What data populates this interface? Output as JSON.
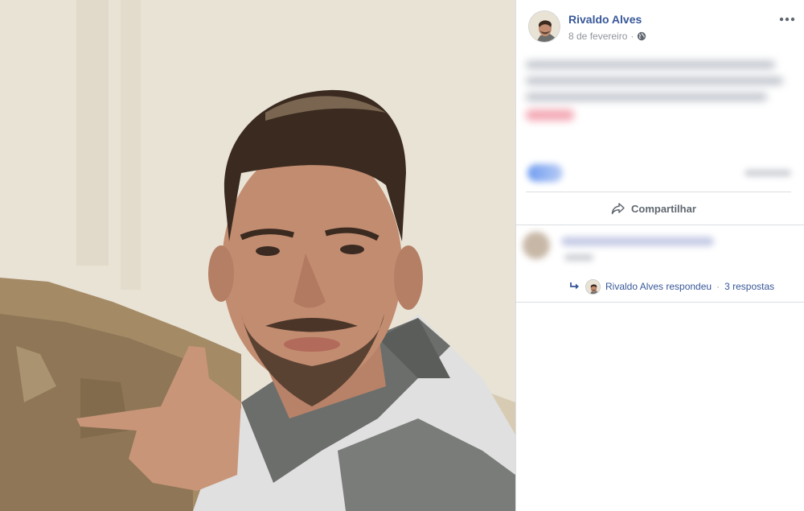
{
  "post": {
    "author": "Rivaldo Alves",
    "date": "8 de fevereiro",
    "date_separator": "·",
    "privacy_icon": "globe-icon",
    "more_icon": "more-options-icon"
  },
  "actions": {
    "share_label": "Compartilhar",
    "share_icon": "share-arrow-icon"
  },
  "replies": {
    "replier": "Rivaldo Alves",
    "replied_label": "Rivaldo Alves respondeu",
    "separator": "·",
    "count_label": "3 respostas"
  },
  "colors": {
    "link_blue": "#385898",
    "muted_gray": "#90949c",
    "divider": "#dadde1"
  }
}
